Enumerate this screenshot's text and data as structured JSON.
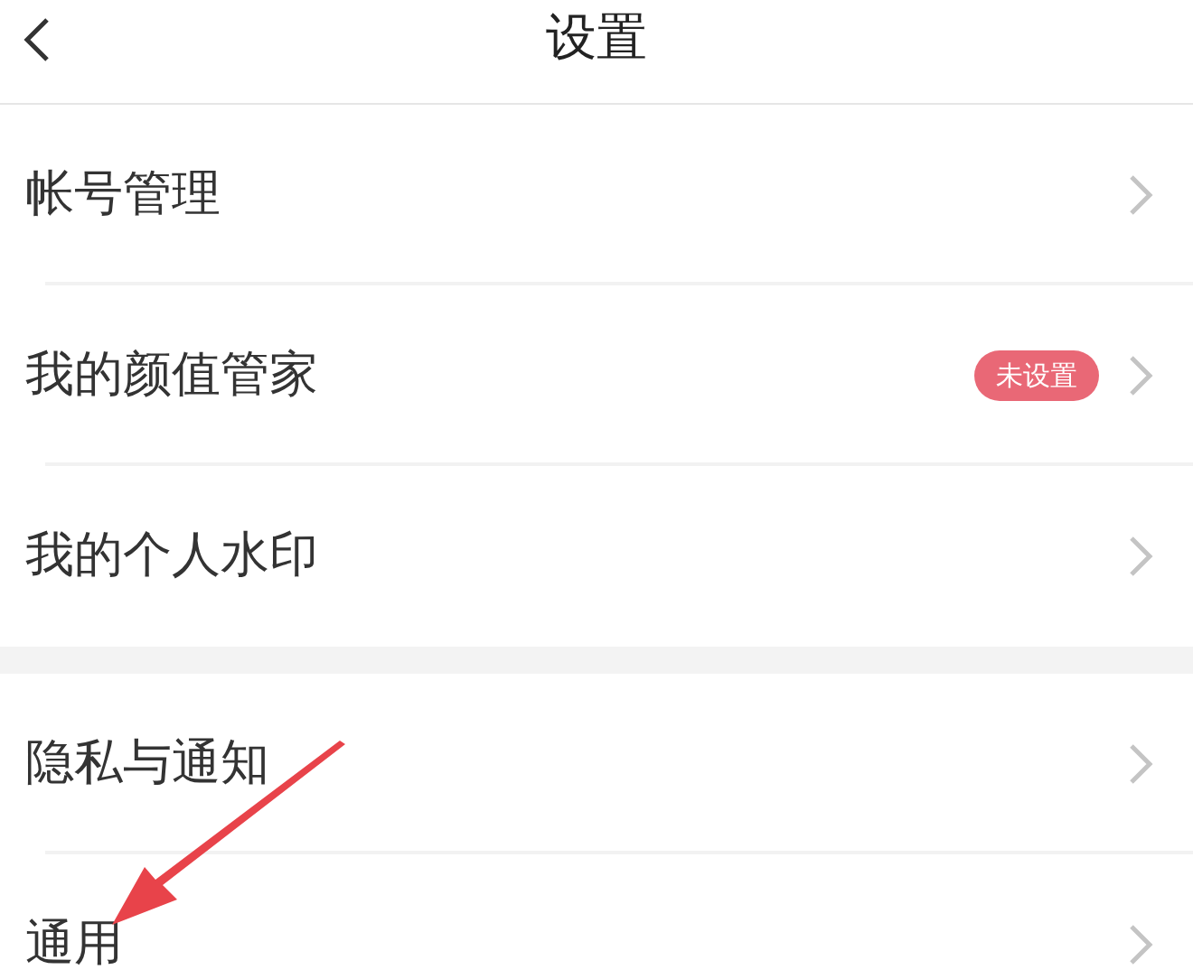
{
  "header": {
    "title": "设置"
  },
  "groups": [
    {
      "items": [
        {
          "label": "帐号管理"
        },
        {
          "label": "我的颜值管家",
          "badge": "未设置"
        },
        {
          "label": "我的个人水印"
        }
      ]
    },
    {
      "items": [
        {
          "label": "隐私与通知"
        },
        {
          "label": "通用"
        }
      ]
    }
  ]
}
